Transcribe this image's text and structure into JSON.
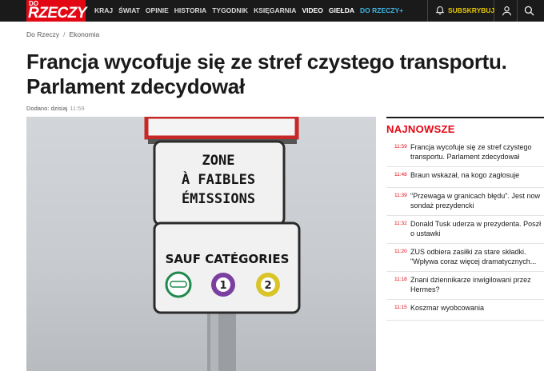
{
  "brand": {
    "logo_top": "DO",
    "logo_main": "RZECZY"
  },
  "nav": {
    "items": [
      "KRAJ",
      "ŚWIAT",
      "OPINIE",
      "HISTORIA",
      "TYGODNIK",
      "KSIĘGARNIA",
      "VIDEO",
      "GIEŁDA",
      "DO RZECZY+"
    ]
  },
  "header": {
    "subscribe_label": "SUBSKRYBUJ",
    "subscribe_color": "#e6c800",
    "icons": [
      "bell-icon",
      "user-icon",
      "search-icon"
    ]
  },
  "breadcrumb": [
    "Do Rzeczy",
    "Ekonomia"
  ],
  "article": {
    "title": "Francja wycofuje się ze stref czystego transportu. Parlament zdecydował",
    "date_label": "Dodano: dzisiaj",
    "time": "11:59"
  },
  "photo_sign": {
    "top_lines": [
      "ZONE",
      "À FAIBLES",
      "ÉMISSIONS"
    ],
    "bottom_title": "SAUF CATÉGORIES",
    "badges": [
      "1",
      "2"
    ]
  },
  "sidebar": {
    "heading": "NAJNOWSZE",
    "items": [
      {
        "time": "11:59",
        "lines": [
          "Francja wycofuje się ze stref czystego",
          "transportu. Parlament zdecydował"
        ]
      },
      {
        "time": "11:48",
        "lines": [
          "Braun wskazał, na kogo zagłosuje"
        ]
      },
      {
        "time": "11:39",
        "lines": [
          "\"Przewaga w granicach błędu\". Jest now",
          "sondaż prezydencki"
        ]
      },
      {
        "time": "11:32",
        "lines": [
          "Donald Tusk uderza w prezydenta. Poszł",
          "o ustawki"
        ]
      },
      {
        "time": "11:20",
        "lines": [
          "ZUS odbiera zasiłki za stare składki.",
          "\"Wpływa coraz więcej dramatycznych..."
        ]
      },
      {
        "time": "11:18",
        "lines": [
          "Znani dziennikarze inwigilowani przez",
          "Hermes?"
        ]
      },
      {
        "time": "11:15",
        "lines": [
          "Koszmar wyobcowania"
        ]
      }
    ]
  },
  "colors": {
    "brand_red": "#e30613",
    "topbar": "#1a1a1a",
    "plus_blue": "#3fb6e8"
  }
}
